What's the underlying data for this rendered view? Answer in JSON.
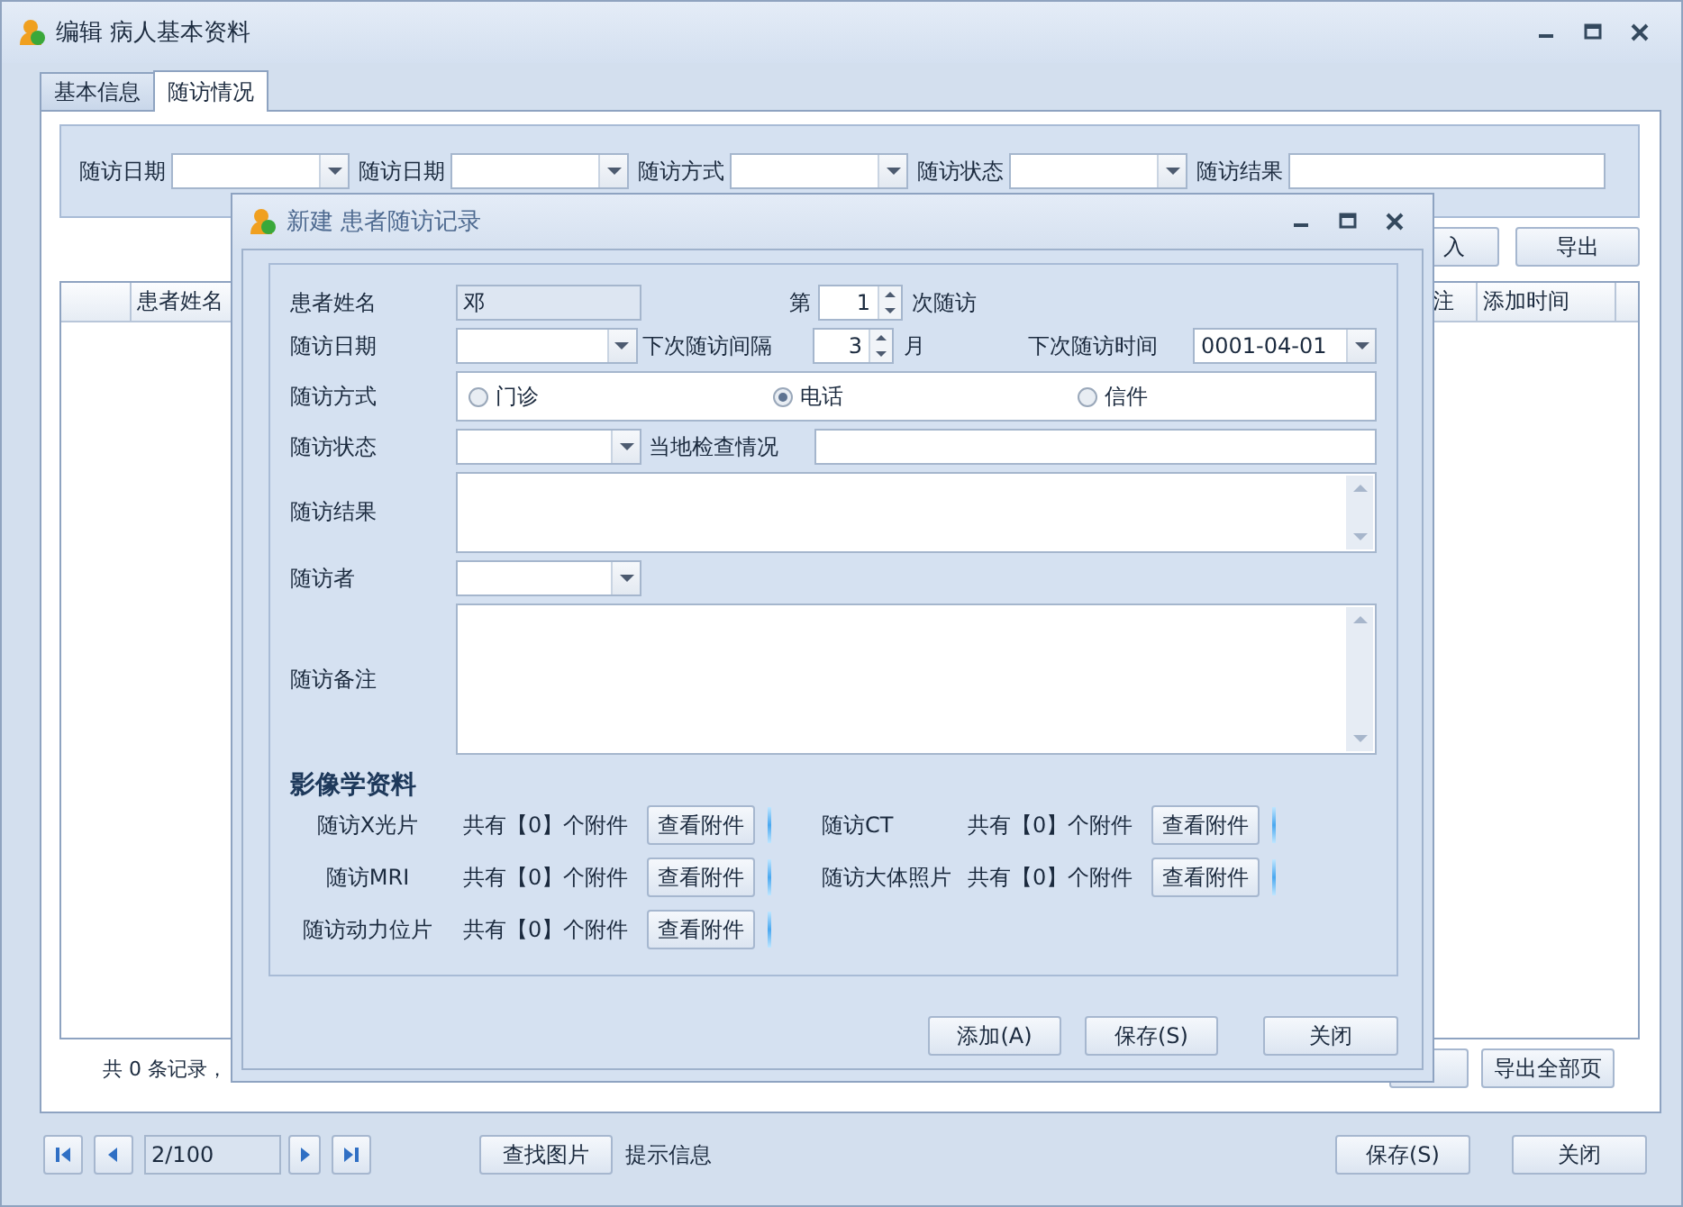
{
  "window": {
    "title": "编辑 病人基本资料"
  },
  "tabs": [
    {
      "label": "基本信息",
      "selected": false
    },
    {
      "label": "随访情况",
      "selected": true
    }
  ],
  "filters": [
    {
      "label": "随访日期",
      "kind": "combo"
    },
    {
      "label": "随访日期",
      "kind": "combo"
    },
    {
      "label": "随访方式",
      "kind": "combo"
    },
    {
      "label": "随访状态",
      "kind": "combo"
    },
    {
      "label": "随访结果",
      "kind": "text"
    }
  ],
  "toolbar_buttons": [
    "入",
    "导出"
  ],
  "table": {
    "columns": [
      {
        "label": "患者姓名"
      },
      {
        "label": "注"
      },
      {
        "label": "添加时间"
      }
    ]
  },
  "record_summary": "共 0 条记录，",
  "footer_button": "导出全部页",
  "pager": {
    "page": "2/100"
  },
  "bottom": {
    "find_button": "查找图片",
    "hint": "提示信息",
    "save_button": "保存(S)",
    "close_button": "关闭"
  },
  "dialog": {
    "title": "新建 患者随访记录",
    "patient_name": {
      "label": "患者姓名",
      "value": "邓"
    },
    "visit_no": {
      "prefix": "第",
      "value": "1",
      "suffix": "次随访"
    },
    "visit_date": {
      "label": "随访日期"
    },
    "interval": {
      "label": "下次随访间隔",
      "value": "3",
      "unit": "月"
    },
    "next_date": {
      "label": "下次随访时间",
      "value": "0001-04-01"
    },
    "method": {
      "label": "随访方式",
      "options": [
        {
          "label": "门诊",
          "selected": false
        },
        {
          "label": "电话",
          "selected": true
        },
        {
          "label": "信件",
          "selected": false
        }
      ]
    },
    "status": {
      "label": "随访状态"
    },
    "local_check": {
      "label": "当地检查情况"
    },
    "result": {
      "label": "随访结果"
    },
    "visitor": {
      "label": "随访者"
    },
    "notes": {
      "label": "随访备注"
    },
    "section_title": "影像学资料",
    "attachments": [
      {
        "label": "随访X光片",
        "count": "共有【0】个附件",
        "button": "查看附件"
      },
      {
        "label": "随访CT",
        "count": "共有【0】个附件",
        "button": "查看附件"
      },
      {
        "label": "随访MRI",
        "count": "共有【0】个附件",
        "button": "查看附件"
      },
      {
        "label": "随访大体照片",
        "count": "共有【0】个附件",
        "button": "查看附件"
      },
      {
        "label": "随访动力位片",
        "count": "共有【0】个附件",
        "button": "查看附件"
      }
    ],
    "buttons": [
      "添加(A)",
      "保存(S)",
      "关闭"
    ]
  }
}
